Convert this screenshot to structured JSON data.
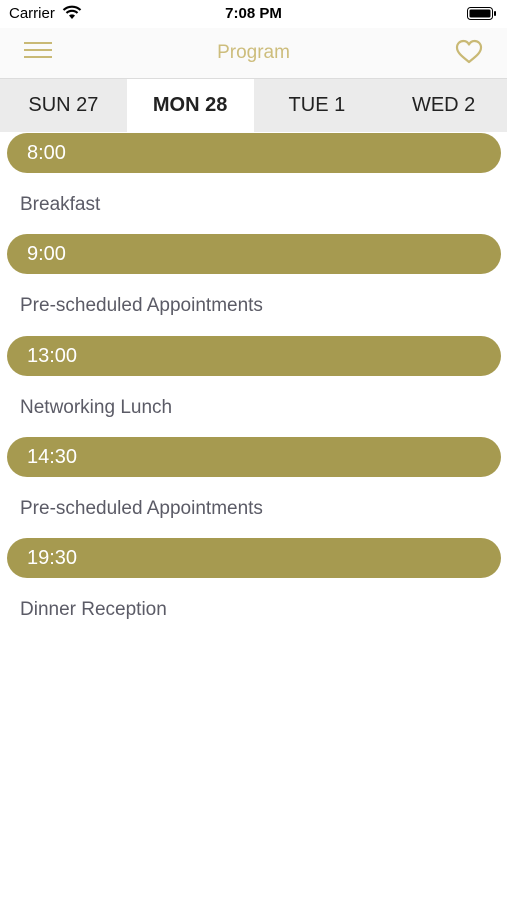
{
  "status_bar": {
    "carrier": "Carrier",
    "time": "7:08 PM"
  },
  "nav": {
    "title": "Program",
    "accent": "#c9b975"
  },
  "tabs": [
    {
      "label": "SUN 27"
    },
    {
      "label": "MON 28"
    },
    {
      "label": "TUE 1"
    },
    {
      "label": "WED 2"
    }
  ],
  "active_tab": "MON 28",
  "colors": {
    "pill": "#a69a50",
    "event_text": "#5b5b66",
    "tab_bar": "#ebebeb"
  },
  "program": [
    {
      "time": "8:00",
      "title": "Breakfast"
    },
    {
      "time": "9:00",
      "title": "Pre-scheduled Appointments"
    },
    {
      "time": "13:00",
      "title": "Networking Lunch"
    },
    {
      "time": "14:30",
      "title": "Pre-scheduled Appointments"
    },
    {
      "time": "19:30",
      "title": "Dinner Reception"
    }
  ]
}
